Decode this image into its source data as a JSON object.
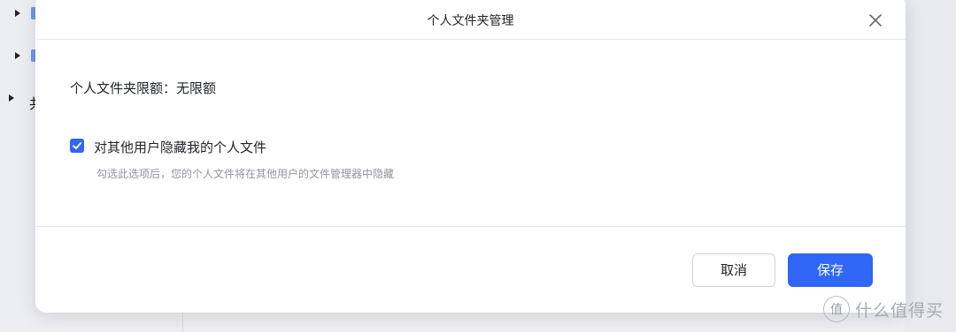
{
  "background": {
    "tree_char": "共"
  },
  "dialog": {
    "title": "个人文件夹管理",
    "quota_label": "个人文件夹限额：无限额",
    "hide_option": {
      "label": "对其他用户隐藏我的个人文件",
      "checked": true,
      "hint": "勾选此选项后，您的个人文件将在其他用户的文件管理器中隐藏"
    },
    "buttons": {
      "cancel": "取消",
      "save": "保存"
    }
  },
  "watermark": {
    "logo": "值",
    "text": "什么值得买"
  },
  "colors": {
    "primary": "#2f66f6",
    "text": "#1f2329",
    "hint": "#8f959e"
  }
}
